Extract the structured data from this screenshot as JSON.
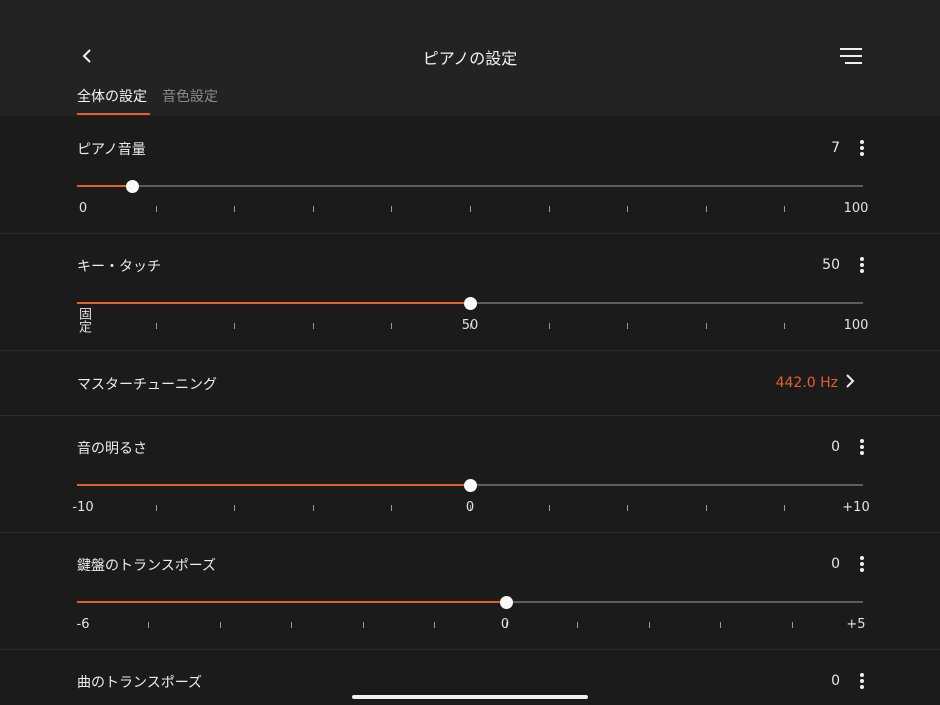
{
  "header": {
    "title": "ピアノの設定",
    "back_icon": "chevron-left-icon",
    "menu_icon": "menu-icon"
  },
  "tabs": [
    {
      "label": "全体の設定",
      "active": true
    },
    {
      "label": "音色設定",
      "active": false
    }
  ],
  "accent_color": "#e4602a",
  "settings": {
    "piano_volume": {
      "label": "ピアノ音量",
      "value": "7",
      "min": 0,
      "max": 100,
      "current": 7,
      "scale_min": "0",
      "scale_max": "100",
      "scale_mid": ""
    },
    "key_touch": {
      "label": "キー・タッチ",
      "value": "50",
      "min": 0,
      "max": 100,
      "current": 50,
      "scale_min": "固定",
      "scale_mid": "50",
      "scale_max": "100"
    },
    "master_tuning": {
      "label": "マスターチューニング",
      "value": "442.0 Hz"
    },
    "brightness": {
      "label": "音の明るさ",
      "value": "0",
      "min": -10,
      "max": 10,
      "current": 0,
      "scale_min": "-10",
      "scale_mid": "0",
      "scale_max": "+10"
    },
    "keyboard_transpose": {
      "label": "鍵盤のトランスポーズ",
      "value": "0",
      "min": -6,
      "max": 5,
      "current": 0,
      "scale_min": "-6",
      "scale_mid": "0",
      "scale_max": "+5"
    },
    "song_transpose": {
      "label": "曲のトランスポーズ",
      "value": "0"
    }
  }
}
